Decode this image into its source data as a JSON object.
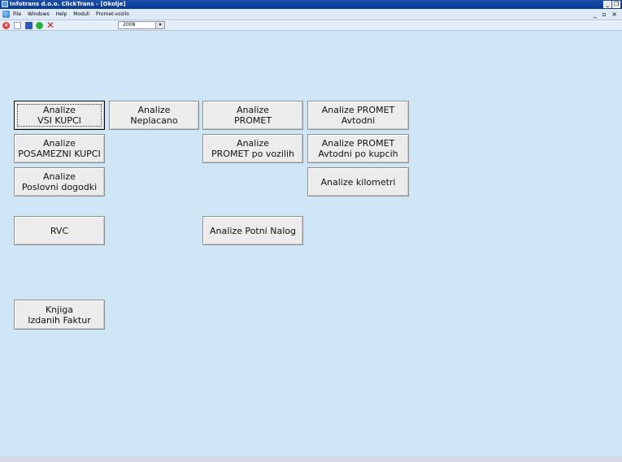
{
  "window": {
    "title": "Infotrans d.o.o. ClickTrans - [Okolje]",
    "minimize_glyph": "_",
    "restore_glyph": "❐"
  },
  "menubar": {
    "items": [
      "File",
      "Windows",
      "Help",
      "Moduli",
      "Promet-vozilo"
    ],
    "mdi_controls": "_ ▫ ×"
  },
  "toolbar": {
    "icons": [
      "stop-icon",
      "new-document-icon",
      "save-icon",
      "refresh-icon",
      "delete-icon"
    ],
    "delete_glyph": "✕",
    "year_value": "2008",
    "dropdown_arrow": "▾"
  },
  "buttons": {
    "analize_vsi_kupci": "Analize\nVSI KUPCI",
    "analize_neplacano": "Analize\nNeplacano",
    "analize_promet": "Analize\nPROMET",
    "analize_promet_avtodni": "Analize PROMET\nAvtodni",
    "analize_posamezni_kupci": "Analize\nPOSAMEZNI KUPCI",
    "analize_promet_po_vozilih": "Analize\nPROMET po vozilih",
    "analize_promet_avtodni_po_kupcih": "Analize PROMET\nAvtodni po kupcih",
    "analize_poslovni_dogodki": "Analize\nPoslovni dogodki",
    "analize_kilometri": "Analize kilometri",
    "rvc": "RVC",
    "analize_potni_nalog": "Analize Potni Nalog",
    "knjiga_izdanih_faktur": "Knjiga\nIzdanih Faktur"
  },
  "colors": {
    "workspace": "#cfe6f7",
    "titlebar": "#0a3a93",
    "button_face": "#ececec"
  }
}
